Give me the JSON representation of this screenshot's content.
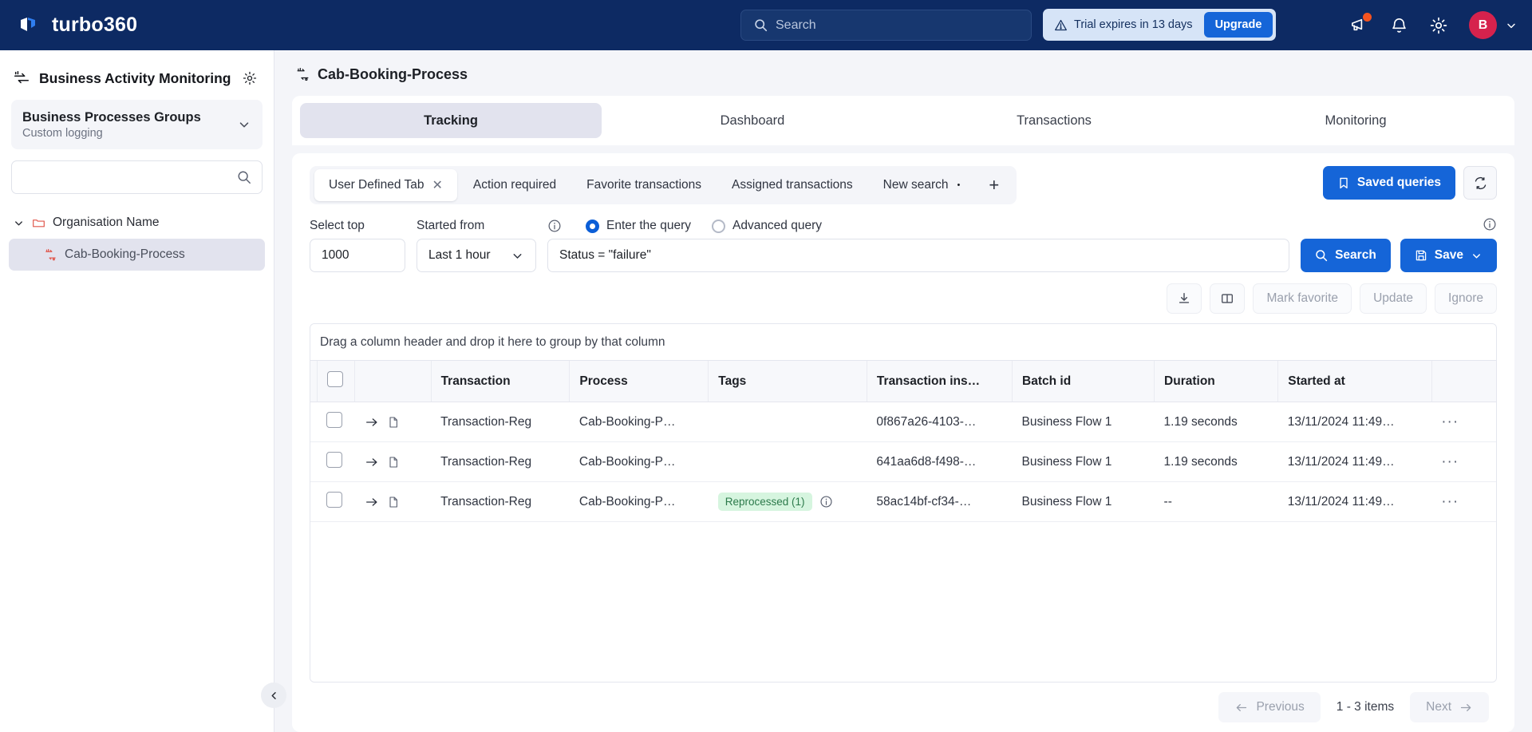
{
  "topbar": {
    "brand": "turbo360",
    "search_placeholder": "Search",
    "trial_text": "Trial expires in 13 days",
    "upgrade_label": "Upgrade",
    "avatar_initial": "B"
  },
  "sidebar": {
    "title": "Business Activity Monitoring",
    "group": {
      "title": "Business Processes Groups",
      "subtitle": "Custom logging"
    },
    "search_placeholder": "",
    "tree": {
      "org_label": "Organisation Name",
      "child_label": "Cab-Booking-Process"
    }
  },
  "main": {
    "breadcrumb": "Cab-Booking-Process",
    "tabs": [
      {
        "label": "Tracking",
        "active": true
      },
      {
        "label": "Dashboard",
        "active": false
      },
      {
        "label": "Transactions",
        "active": false
      },
      {
        "label": "Monitoring",
        "active": false
      }
    ],
    "subtabs": [
      {
        "label": "User Defined Tab",
        "active": true,
        "closable": true,
        "dirty": false
      },
      {
        "label": "Action required",
        "active": false,
        "closable": false,
        "dirty": false
      },
      {
        "label": "Favorite transactions",
        "active": false,
        "closable": false,
        "dirty": false
      },
      {
        "label": "Assigned transactions",
        "active": false,
        "closable": false,
        "dirty": false
      },
      {
        "label": "New search",
        "active": false,
        "closable": false,
        "dirty": true
      }
    ],
    "add_tab_label": "+",
    "saved_queries_label": "Saved queries",
    "query": {
      "select_top_label": "Select top",
      "select_top_value": "1000",
      "started_from_label": "Started from",
      "started_from_value": "Last 1 hour",
      "radio_enter_label": "Enter the query",
      "radio_advanced_label": "Advanced query",
      "query_value": "Status = \"failure\"",
      "search_label": "Search",
      "save_label": "Save"
    },
    "toolbar": {
      "mark_favorite_label": "Mark favorite",
      "update_label": "Update",
      "ignore_label": "Ignore"
    },
    "grid": {
      "group_hint": "Drag a column header and drop it here to group by that column",
      "columns": [
        "",
        "",
        "",
        "Transaction",
        "Process",
        "Tags",
        "Transaction ins…",
        "Batch id",
        "Duration",
        "Started at",
        ""
      ],
      "rows": [
        {
          "transaction": "Transaction-Reg",
          "process": "Cab-Booking-P…",
          "tag": "",
          "transaction_instance": "0f867a26-4103-…",
          "batch_id": "Business Flow 1",
          "duration": "1.19 seconds",
          "started_at": "13/11/2024 11:49…"
        },
        {
          "transaction": "Transaction-Reg",
          "process": "Cab-Booking-P…",
          "tag": "",
          "transaction_instance": "641aa6d8-f498-…",
          "batch_id": "Business Flow 1",
          "duration": "1.19 seconds",
          "started_at": "13/11/2024 11:49…"
        },
        {
          "transaction": "Transaction-Reg",
          "process": "Cab-Booking-P…",
          "tag": "Reprocessed (1)",
          "transaction_instance": "58ac14bf-cf34-…",
          "batch_id": "Business Flow 1",
          "duration": "--",
          "started_at": "13/11/2024 11:49…"
        }
      ],
      "more_glyph": "···"
    },
    "pager": {
      "previous_label": "Previous",
      "count_label": "1 - 3 items",
      "next_label": "Next"
    }
  },
  "colors": {
    "brand_navy": "#0d2a63",
    "accent_blue": "#1565d8",
    "avatar_red": "#d6224d",
    "row_flag_red": "#e03a2f",
    "badge_green_bg": "#d6f5df",
    "badge_green_fg": "#2c7a4b"
  }
}
